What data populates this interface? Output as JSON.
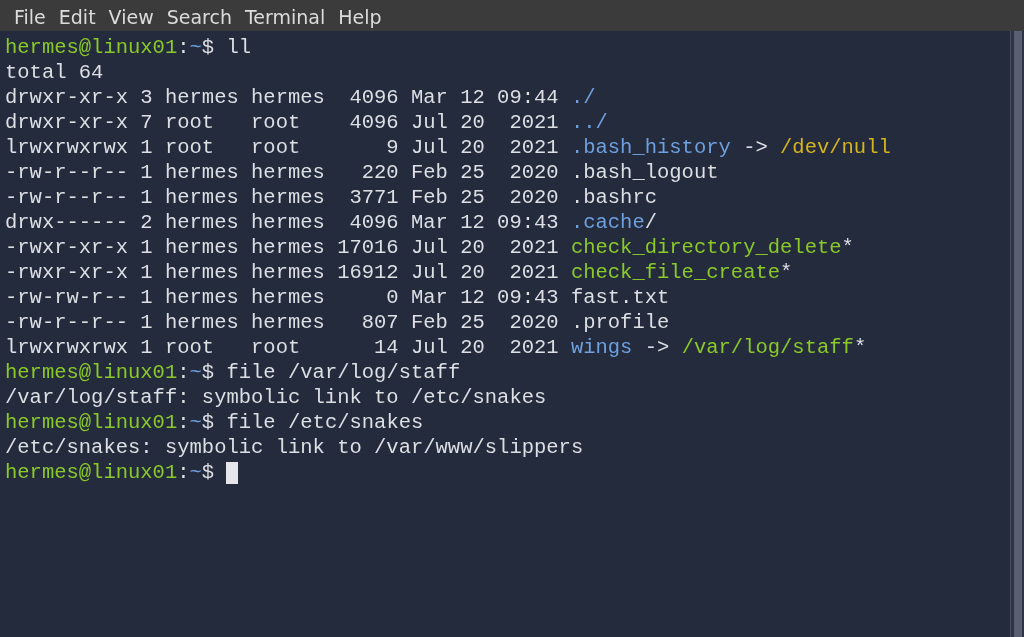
{
  "menu": [
    {
      "label": "File"
    },
    {
      "label": "Edit"
    },
    {
      "label": "View"
    },
    {
      "label": "Search"
    },
    {
      "label": "Terminal"
    },
    {
      "label": "Help"
    }
  ],
  "lines": [
    {
      "segments": [
        {
          "text": "hermes@linux01",
          "kind": "user"
        },
        {
          "text": ":",
          "kind": "plain"
        },
        {
          "text": "~",
          "kind": "path"
        },
        {
          "text": "$ ll",
          "kind": "plain"
        }
      ]
    },
    {
      "segments": [
        {
          "text": "total 64",
          "kind": "plain"
        }
      ]
    },
    {
      "segments": [
        {
          "text": "drwxr-xr-x 3 hermes hermes  4096 Mar 12 09:44 ",
          "kind": "plain"
        },
        {
          "text": "./",
          "kind": "dir"
        }
      ]
    },
    {
      "segments": [
        {
          "text": "drwxr-xr-x 7 root   root    4096 Jul 20  2021 ",
          "kind": "plain"
        },
        {
          "text": "../",
          "kind": "dir"
        }
      ]
    },
    {
      "segments": [
        {
          "text": "lrwxrwxrwx 1 root   root       9 Jul 20  2021 ",
          "kind": "plain"
        },
        {
          "text": ".bash_history",
          "kind": "link"
        },
        {
          "text": " -> ",
          "kind": "plain"
        },
        {
          "text": "/dev/null",
          "kind": "target"
        }
      ]
    },
    {
      "segments": [
        {
          "text": "-rw-r--r-- 1 hermes hermes   220 Feb 25  2020 .bash_logout",
          "kind": "plain"
        }
      ]
    },
    {
      "segments": [
        {
          "text": "-rw-r--r-- 1 hermes hermes  3771 Feb 25  2020 .bashrc",
          "kind": "plain"
        }
      ]
    },
    {
      "segments": [
        {
          "text": "drwx------ 2 hermes hermes  4096 Mar 12 09:43 ",
          "kind": "plain"
        },
        {
          "text": ".cache",
          "kind": "dir"
        },
        {
          "text": "/",
          "kind": "plain"
        }
      ]
    },
    {
      "segments": [
        {
          "text": "-rwxr-xr-x 1 hermes hermes 17016 Jul 20  2021 ",
          "kind": "plain"
        },
        {
          "text": "check_directory_delete",
          "kind": "exec"
        },
        {
          "text": "*",
          "kind": "plain"
        }
      ]
    },
    {
      "segments": [
        {
          "text": "-rwxr-xr-x 1 hermes hermes 16912 Jul 20  2021 ",
          "kind": "plain"
        },
        {
          "text": "check_file_create",
          "kind": "exec"
        },
        {
          "text": "*",
          "kind": "plain"
        }
      ]
    },
    {
      "segments": [
        {
          "text": "-rw-rw-r-- 1 hermes hermes     0 Mar 12 09:43 fast.txt",
          "kind": "plain"
        }
      ]
    },
    {
      "segments": [
        {
          "text": "-rw-r--r-- 1 hermes hermes   807 Feb 25  2020 .profile",
          "kind": "plain"
        }
      ]
    },
    {
      "segments": [
        {
          "text": "lrwxrwxrwx 1 root   root      14 Jul 20  2021 ",
          "kind": "plain"
        },
        {
          "text": "wings",
          "kind": "link"
        },
        {
          "text": " -> ",
          "kind": "plain"
        },
        {
          "text": "/var/log/staff",
          "kind": "exec"
        },
        {
          "text": "*",
          "kind": "plain"
        }
      ]
    },
    {
      "segments": [
        {
          "text": "hermes@linux01",
          "kind": "user"
        },
        {
          "text": ":",
          "kind": "plain"
        },
        {
          "text": "~",
          "kind": "path"
        },
        {
          "text": "$ file /var/log/staff",
          "kind": "plain"
        }
      ]
    },
    {
      "segments": [
        {
          "text": "/var/log/staff: symbolic link to /etc/snakes",
          "kind": "plain"
        }
      ]
    },
    {
      "segments": [
        {
          "text": "hermes@linux01",
          "kind": "user"
        },
        {
          "text": ":",
          "kind": "plain"
        },
        {
          "text": "~",
          "kind": "path"
        },
        {
          "text": "$ file /etc/snakes",
          "kind": "plain"
        }
      ]
    },
    {
      "segments": [
        {
          "text": "/etc/snakes: symbolic link to /var/www/slippers",
          "kind": "plain"
        }
      ]
    },
    {
      "segments": [
        {
          "text": "hermes@linux01",
          "kind": "user"
        },
        {
          "text": ":",
          "kind": "plain"
        },
        {
          "text": "~",
          "kind": "path"
        },
        {
          "text": "$ ",
          "kind": "plain"
        }
      ],
      "cursor": true
    }
  ]
}
